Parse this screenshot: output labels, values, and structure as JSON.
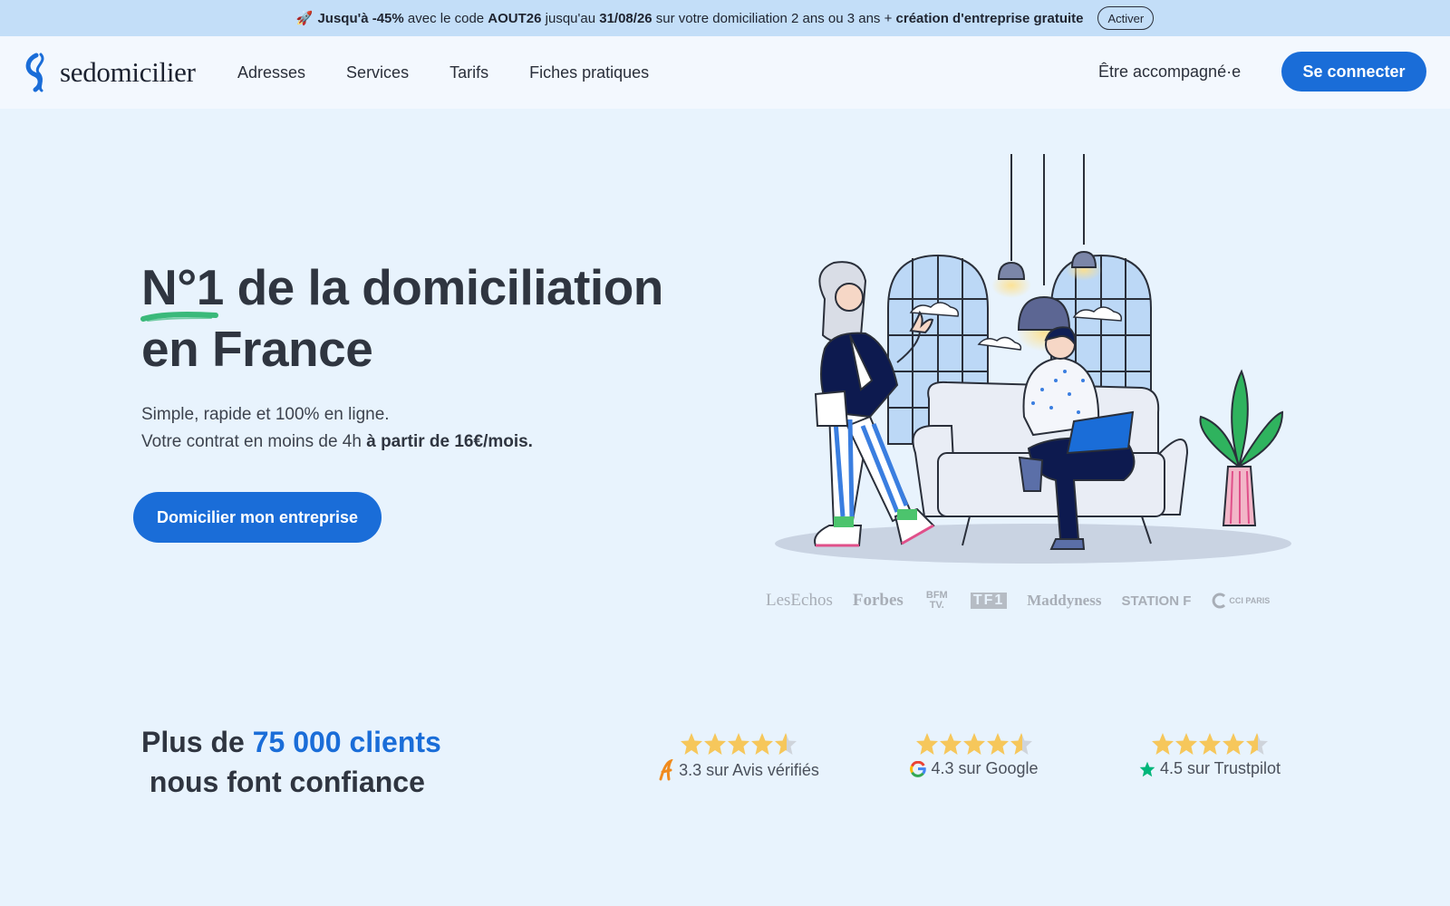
{
  "promo": {
    "emoji": "🚀",
    "highlight": "Jusqu'à -45%",
    "text1": " avec le code ",
    "code": "AOUT26",
    "text2": " jusqu'au ",
    "date": "31/08/26",
    "text3": " sur votre domiciliation 2 ans ou 3 ans + ",
    "offer": "création d'entreprise gratuite",
    "button": "Activer"
  },
  "header": {
    "logo": "sedomicilier",
    "nav": [
      "Adresses",
      "Services",
      "Tarifs",
      "Fiches pratiques"
    ],
    "help": "Être accompagné·e",
    "login": "Se connecter"
  },
  "hero": {
    "title_line1": "N°1 de la domiciliation",
    "title_line2": "en France",
    "sub_line1": "Simple, rapide et 100% en ligne.",
    "sub_line2": "Votre contrat en moins de 4h ",
    "sub_price": "à partir de 16€/mois.",
    "cta": "Domicilier mon entreprise"
  },
  "press": {
    "logos": [
      "LesEchos",
      "Forbes",
      "BFM TV.",
      "TF1",
      "Maddyness",
      "STATION F",
      "CCI PARIS"
    ]
  },
  "trust": {
    "prefix": "Plus de ",
    "highlight": "75 000 clients",
    "suffix": " nous font confiance",
    "ratings": [
      {
        "score": 4.5,
        "text": "3.3 sur Avis vérifiés",
        "icon": "avis-verifies-icon"
      },
      {
        "score": 4.5,
        "text": "4.3 sur Google",
        "icon": "google-icon"
      },
      {
        "score": 4.5,
        "text": "4.5 sur Trustpilot",
        "icon": "trustpilot-star-icon"
      }
    ]
  },
  "colors": {
    "accent": "#1a6dd8",
    "page_bg": "#e8f3fd",
    "promo_bg": "#c3def8",
    "star": "#f6c75b"
  }
}
